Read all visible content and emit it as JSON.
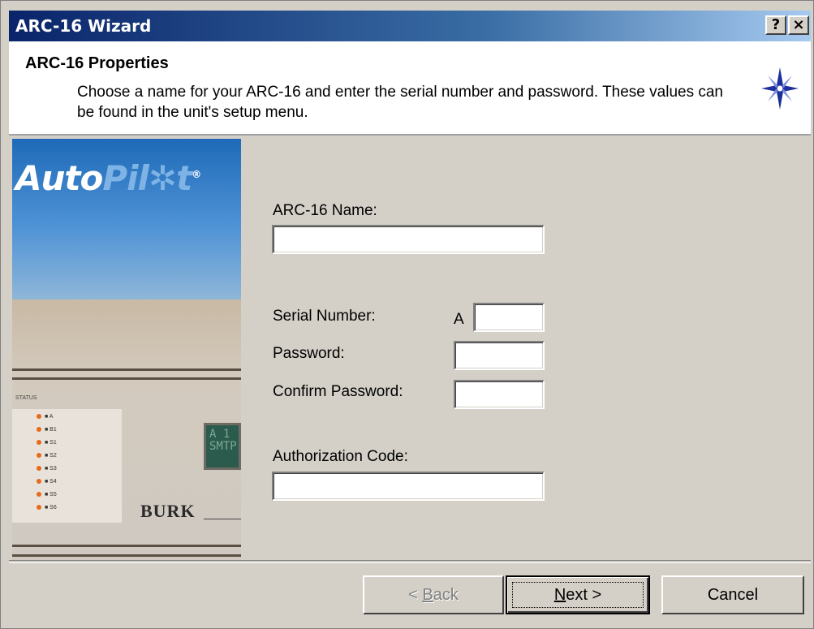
{
  "window": {
    "title": "ARC-16 Wizard",
    "help_glyph": "?",
    "close_glyph": "×"
  },
  "header": {
    "title": "ARC-16 Properties",
    "description": "Choose a name for your ARC-16 and enter the serial number and password. These values can be found in the unit's setup menu."
  },
  "banner": {
    "logo_auto": "Auto",
    "logo_pilot": "Pil✲t",
    "logo_reg": "®",
    "status_label": "STATUS",
    "led_labels": [
      "■ A",
      "■ B1",
      "■ S1",
      "■ S2",
      "■ S3",
      "■ S4",
      "■ S5",
      "■ S6"
    ],
    "lcd_text": "A 1\nSMTP",
    "brand": "BURK"
  },
  "form": {
    "name_label": "ARC-16 Name:",
    "name_value": "",
    "serial_label": "Serial Number:",
    "serial_prefix": "A",
    "serial_value": "",
    "password_label": "Password:",
    "password_value": "",
    "confirm_label": "Confirm Password:",
    "confirm_value": "",
    "auth_label": "Authorization Code:",
    "auth_value": ""
  },
  "buttons": {
    "back_prefix": "< ",
    "back_key": "B",
    "back_rest": "ack",
    "next_key": "N",
    "next_rest": "ext >",
    "cancel": "Cancel"
  },
  "colors": {
    "titlebar_start": "#0a246a",
    "titlebar_end": "#a6caf0",
    "dialog_bg": "#d4d0c8"
  }
}
